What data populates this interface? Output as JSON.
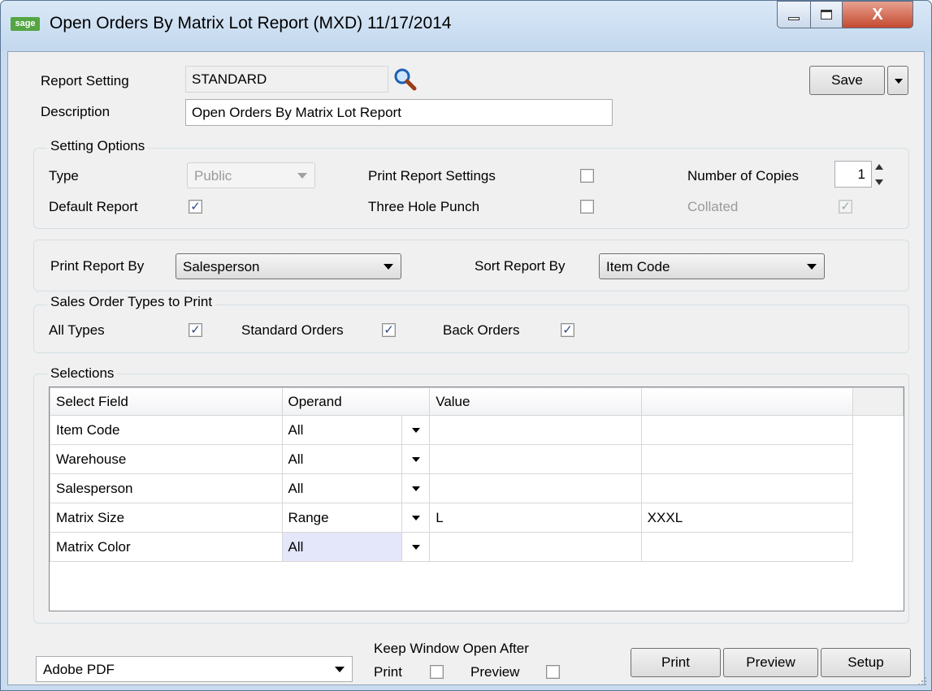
{
  "window": {
    "app_icon": "sage",
    "title": "Open Orders By Matrix Lot Report (MXD) 11/17/2014",
    "close_glyph": "X"
  },
  "report": {
    "setting_label": "Report Setting",
    "setting_value": "STANDARD",
    "description_label": "Description",
    "description_value": "Open Orders By Matrix Lot Report",
    "save_label": "Save"
  },
  "setting_options": {
    "title": "Setting Options",
    "type_label": "Type",
    "type_value": "Public",
    "default_report_label": "Default Report",
    "default_report_checked": true,
    "print_settings_label": "Print Report Settings",
    "print_settings_checked": false,
    "three_hole_label": "Three Hole Punch",
    "three_hole_checked": false,
    "copies_label": "Number of Copies",
    "copies_value": "1",
    "collated_label": "Collated",
    "collated_checked": true
  },
  "print_options": {
    "print_by_label": "Print Report By",
    "print_by_value": "Salesperson",
    "sort_by_label": "Sort Report By",
    "sort_by_value": "Item Code"
  },
  "order_types": {
    "title": "Sales Order Types to Print",
    "all_label": "All Types",
    "standard_label": "Standard Orders",
    "back_label": "Back Orders"
  },
  "selections": {
    "title": "Selections",
    "headers": [
      "Select Field",
      "Operand",
      "Value",
      ""
    ],
    "rows": [
      {
        "field": "Item Code",
        "operand": "All",
        "value": "",
        "value2": ""
      },
      {
        "field": "Warehouse",
        "operand": "All",
        "value": "",
        "value2": ""
      },
      {
        "field": "Salesperson",
        "operand": "All",
        "value": "",
        "value2": ""
      },
      {
        "field": "Matrix Size",
        "operand": "Range",
        "value": "L",
        "value2": "XXXL"
      },
      {
        "field": "Matrix Color",
        "operand": "All",
        "value": "",
        "value2": ""
      }
    ]
  },
  "footer": {
    "printer_value": "Adobe PDF",
    "keep_open_label": "Keep Window Open After",
    "print_label": "Print",
    "preview_label": "Preview",
    "print_button": "Print",
    "preview_button": "Preview",
    "setup_button": "Setup"
  }
}
